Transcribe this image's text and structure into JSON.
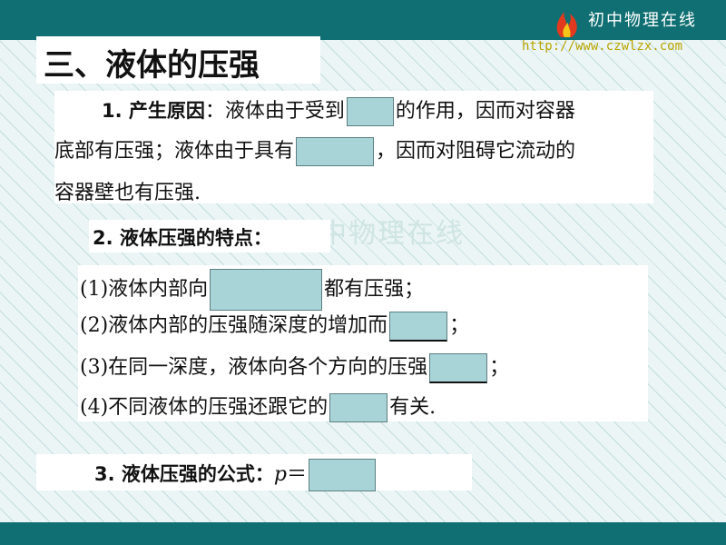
{
  "brand": {
    "name": "初中物理在线",
    "url": "http://www.czwlzx.com"
  },
  "watermark": "初中物理在线",
  "section_title": "三、液体的压强",
  "point1": {
    "label": "1. 产生原因",
    "line1_a": "：液体由于受到",
    "line1_b": "的作用，因而对容器",
    "line2_a": "底部有压强；液体由于具有",
    "line2_b": "，因而对阻碍它流动的",
    "line3": "容器壁也有压强."
  },
  "point2": {
    "label": "2. 液体压强的特点：",
    "item1_a": "(1)液体内部向",
    "item1_b": "都有压强；",
    "item2_a": "(2)液体内部的压强随深度的增加而",
    "item2_b": "；",
    "item3_a": "(3)在同一深度，液体向各个方向的压强",
    "item3_b": "；",
    "item4_a": "(4)不同液体的压强还跟它的",
    "item4_b": "有关."
  },
  "point3": {
    "label": "3. 液体压强的公式：",
    "formula": "p =",
    "formula_var": "p",
    "formula_eq": "＝"
  },
  "colors": {
    "bar": "#0f6f72",
    "blank_fill": "#a8d4d8",
    "brand_url": "#b9a400"
  }
}
